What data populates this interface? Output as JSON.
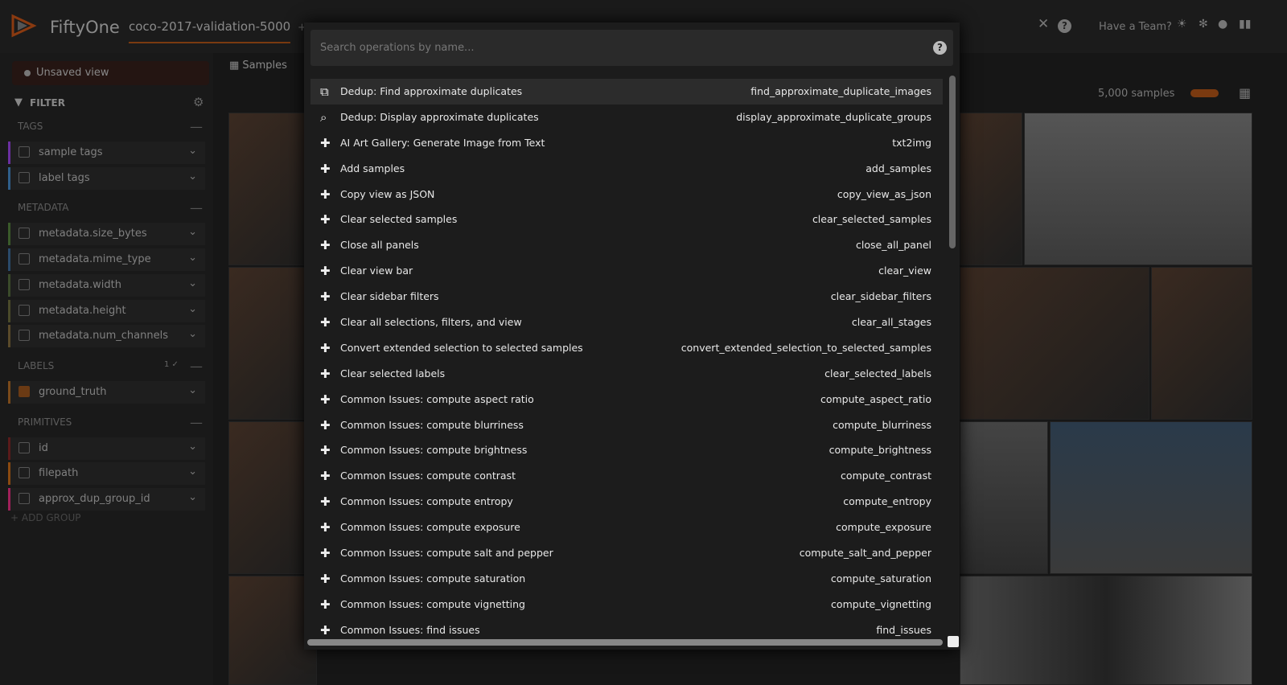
{
  "header": {
    "brand": "FiftyOne",
    "dataset": "coco-2017-validation-5000",
    "add_tab": "+ a",
    "team": "Have a Team?"
  },
  "sidebar": {
    "view": "Unsaved view",
    "filter": "FILTER",
    "sections": [
      {
        "title": "TAGS",
        "items": [
          {
            "label": "sample tags",
            "color": "#6b2fa0"
          },
          {
            "label": "label tags",
            "color": "#2f5f8a"
          }
        ]
      },
      {
        "title": "METADATA",
        "items": [
          {
            "label": "metadata.size_bytes",
            "color": "#3a5a2a"
          },
          {
            "label": "metadata.mime_type",
            "color": "#2a4a6a"
          },
          {
            "label": "metadata.width",
            "color": "#3a4a2a"
          },
          {
            "label": "metadata.height",
            "color": "#4a4a2a"
          },
          {
            "label": "metadata.num_channels",
            "color": "#5a4a2a"
          }
        ]
      },
      {
        "title": "LABELS",
        "count": "1 ✓",
        "items": [
          {
            "label": "ground_truth",
            "color": "#7a4a1a",
            "checked": true
          }
        ]
      },
      {
        "title": "PRIMITIVES",
        "items": [
          {
            "label": "id",
            "color": "#5a1a1a"
          },
          {
            "label": "filepath",
            "color": "#8a4a10"
          },
          {
            "label": "approx_dup_group_id",
            "color": "#a0205a"
          }
        ]
      }
    ],
    "add_group": "+ ADD GROUP"
  },
  "main": {
    "tab": "Samples",
    "count": "5,000 samples"
  },
  "operator_browser": {
    "placeholder": "Search operations by name...",
    "items": [
      {
        "label": "Dedup: Find approximate duplicates",
        "name": "find_approximate_duplicate_images",
        "icon": "copy-icon"
      },
      {
        "label": "Dedup: Display approximate duplicates",
        "name": "display_approximate_duplicate_groups",
        "icon": "search-icon"
      },
      {
        "label": "AI Art Gallery: Generate Image from Text",
        "name": "txt2img",
        "icon": "puzzle-icon"
      },
      {
        "label": "Add samples",
        "name": "add_samples",
        "icon": "puzzle-icon"
      },
      {
        "label": "Copy view as JSON",
        "name": "copy_view_as_json",
        "icon": "puzzle-icon"
      },
      {
        "label": "Clear selected samples",
        "name": "clear_selected_samples",
        "icon": "puzzle-icon"
      },
      {
        "label": "Close all panels",
        "name": "close_all_panel",
        "icon": "puzzle-icon"
      },
      {
        "label": "Clear view bar",
        "name": "clear_view",
        "icon": "puzzle-icon"
      },
      {
        "label": "Clear sidebar filters",
        "name": "clear_sidebar_filters",
        "icon": "puzzle-icon"
      },
      {
        "label": "Clear all selections, filters, and view",
        "name": "clear_all_stages",
        "icon": "puzzle-icon"
      },
      {
        "label": "Convert extended selection to selected samples",
        "name": "convert_extended_selection_to_selected_samples",
        "icon": "puzzle-icon"
      },
      {
        "label": "Clear selected labels",
        "name": "clear_selected_labels",
        "icon": "puzzle-icon"
      },
      {
        "label": "Common Issues: compute aspect ratio",
        "name": "compute_aspect_ratio",
        "icon": "puzzle-icon"
      },
      {
        "label": "Common Issues: compute blurriness",
        "name": "compute_blurriness",
        "icon": "puzzle-icon"
      },
      {
        "label": "Common Issues: compute brightness",
        "name": "compute_brightness",
        "icon": "puzzle-icon"
      },
      {
        "label": "Common Issues: compute contrast",
        "name": "compute_contrast",
        "icon": "puzzle-icon"
      },
      {
        "label": "Common Issues: compute entropy",
        "name": "compute_entropy",
        "icon": "puzzle-icon"
      },
      {
        "label": "Common Issues: compute exposure",
        "name": "compute_exposure",
        "icon": "puzzle-icon"
      },
      {
        "label": "Common Issues: compute salt and pepper",
        "name": "compute_salt_and_pepper",
        "icon": "puzzle-icon"
      },
      {
        "label": "Common Issues: compute saturation",
        "name": "compute_saturation",
        "icon": "puzzle-icon"
      },
      {
        "label": "Common Issues: compute vignetting",
        "name": "compute_vignetting",
        "icon": "puzzle-icon"
      },
      {
        "label": "Common Issues: find issues",
        "name": "find_issues",
        "icon": "puzzle-icon"
      }
    ]
  },
  "colors": {
    "accent": "#e8630a",
    "background": "#141414",
    "modal": "#1c1c1c"
  }
}
